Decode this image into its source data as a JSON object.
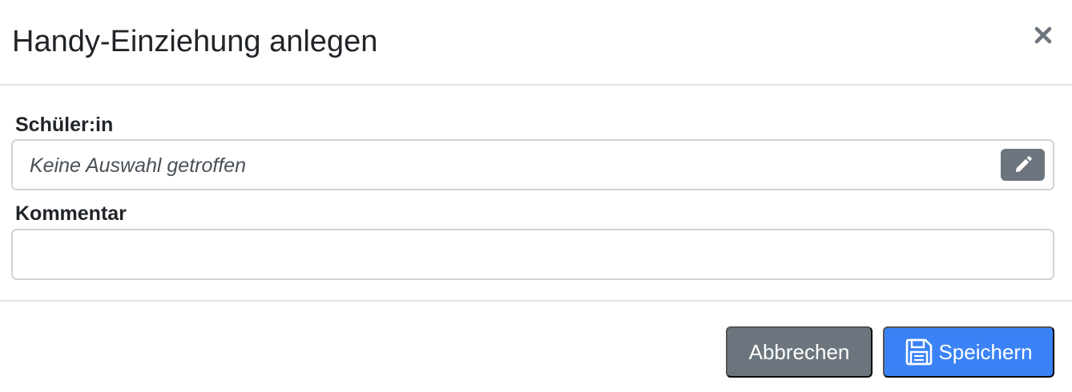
{
  "modal": {
    "title": "Handy-Einziehung anlegen",
    "close_icon": "close-icon"
  },
  "form": {
    "student_label": "Schüler:in",
    "student_value": "Keine Auswahl getroffen",
    "student_edit_icon": "pencil-icon",
    "comment_label": "Kommentar",
    "comment_value": ""
  },
  "footer": {
    "cancel_label": "Abbrechen",
    "save_label": "Speichern",
    "save_icon": "floppy-disk-icon"
  },
  "colors": {
    "secondary": "#6c757d",
    "primary": "#3b82f6",
    "border": "#ced4da",
    "divider": "#dee2e6"
  }
}
